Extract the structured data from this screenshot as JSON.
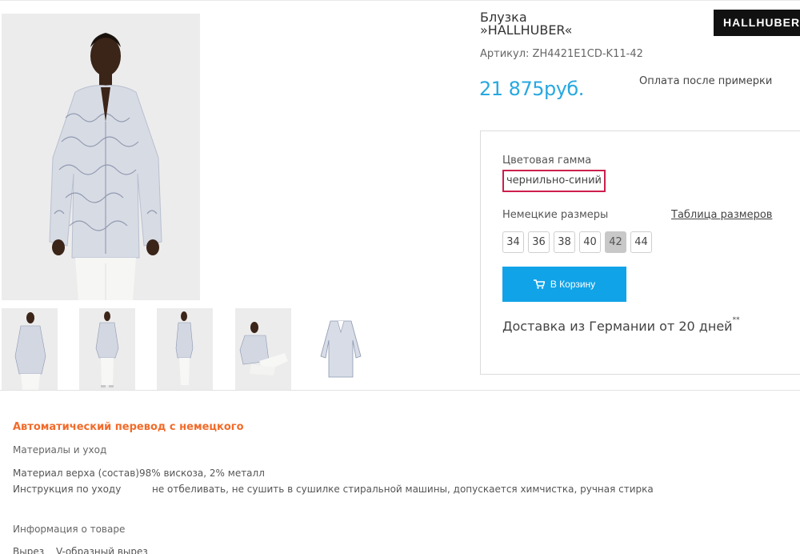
{
  "product": {
    "title_line1": "Блузка",
    "title_line2": "»HALLHUBER«",
    "brand_logo_text": "HALLHUBER",
    "sku": "Артикул: ZH4421E1CD-K11-42",
    "price": "21 875руб.",
    "payment_note": "Оплата после примерки"
  },
  "images": {
    "main": "model-front-image",
    "thumbnails": [
      "thumb-front",
      "thumb-front-full",
      "thumb-side",
      "thumb-sitting",
      "thumb-flat"
    ]
  },
  "options": {
    "color_label": "Цветовая гамма",
    "color_value": "чернильно-синий",
    "size_label": "Немецкие размеры",
    "size_table_link": "Таблица размеров",
    "sizes": [
      "34",
      "36",
      "38",
      "40",
      "42",
      "44"
    ],
    "selected_size": "42",
    "cart_button": "В Корзину",
    "delivery": "Доставка из Германии от 20 дней",
    "delivery_mark": "**"
  },
  "description": {
    "auto_translate": "Автоматический перевод с немецкого",
    "materials_heading": "Материалы и уход",
    "material_label": "Материал верха (состав)",
    "material_value": "98% вискоза, 2% металл",
    "care_label": "Инструкция по уходу",
    "care_value": "не отбеливать, не сушить в сушилке стиральной машины, допускается химчистка, ручная стирка",
    "info_heading": "Информация о товаре",
    "neck_label": "Вырез",
    "neck_value": "V-образный вырез"
  },
  "colors": {
    "price": "#28a8e0",
    "cart_button": "#11a3e8",
    "accent_orange": "#f26b2a",
    "color_highlight_border": "#cc1f4d",
    "selected_size_bg": "#c8c8c8"
  }
}
